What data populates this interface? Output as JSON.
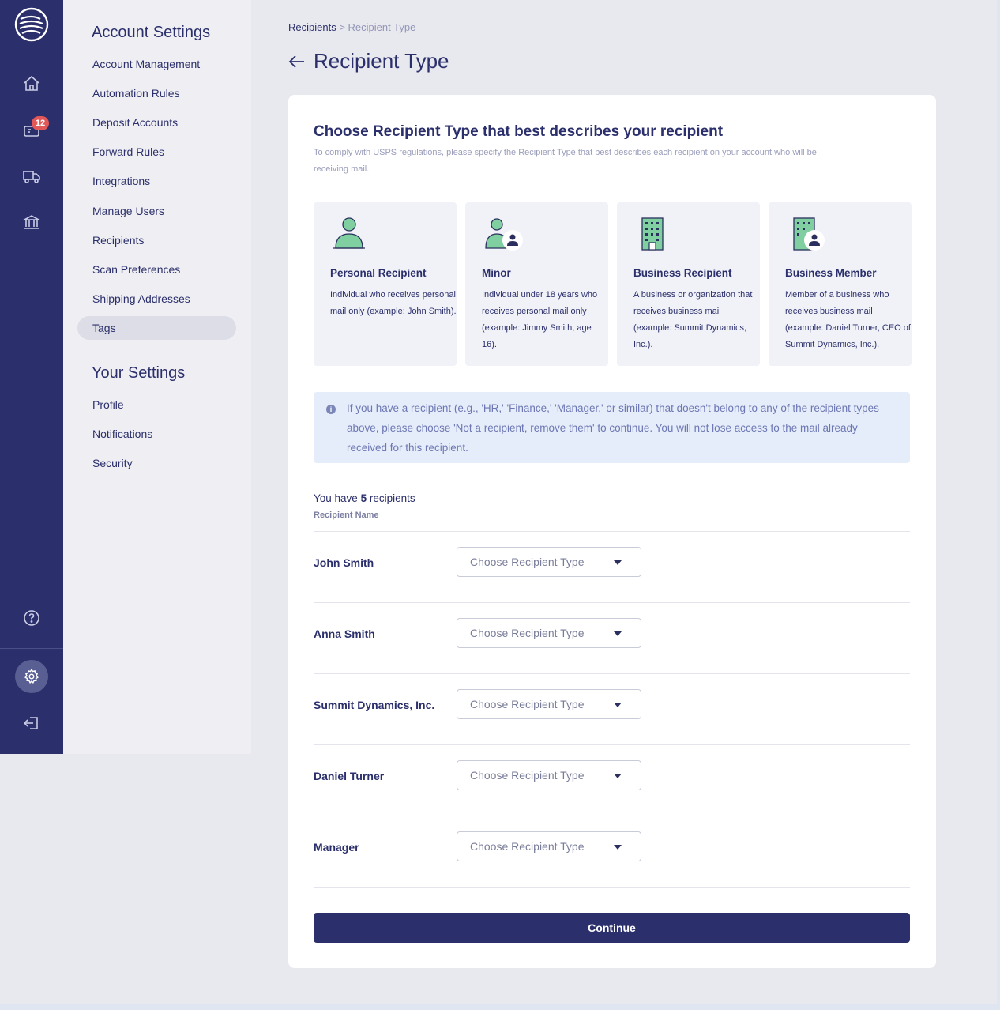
{
  "sidebar_rail": {
    "icons": [
      "logo-icon",
      "home-icon",
      "mailbox-icon",
      "truck-icon",
      "bank-icon",
      "help-icon",
      "gear-icon",
      "logout-icon"
    ],
    "mail_badge": "12"
  },
  "settings_menu": {
    "account_heading": "Account Settings",
    "account_items": [
      {
        "label": "Account Management"
      },
      {
        "label": "Automation Rules"
      },
      {
        "label": "Deposit Accounts"
      },
      {
        "label": "Forward Rules"
      },
      {
        "label": "Integrations"
      },
      {
        "label": "Manage Users"
      },
      {
        "label": "Recipients"
      },
      {
        "label": "Scan Preferences"
      },
      {
        "label": "Shipping Addresses"
      },
      {
        "label": "Tags"
      }
    ],
    "your_heading": "Your Settings",
    "your_items": [
      {
        "label": "Profile"
      },
      {
        "label": "Notifications"
      },
      {
        "label": "Security"
      }
    ]
  },
  "breadcrumb": {
    "parent": "Recipients",
    "separator": ">",
    "current": "Recipient Type"
  },
  "page_title": "Recipient Type",
  "card": {
    "heading": "Choose Recipient Type that best describes your recipient",
    "subheading": "To comply with USPS regulations, please specify the Recipient Type that best describes each recipient on your account who will be receiving mail.",
    "types": [
      {
        "name": "Personal Recipient",
        "description": "Individual who receives personal mail only (example: John Smith)."
      },
      {
        "name": "Minor",
        "description": "Individual under 18 years who receives personal mail only (example: Jimmy Smith, age 16)."
      },
      {
        "name": "Business Recipient",
        "description": "A business or organization that receives business mail (example: Summit Dynamics, Inc.)."
      },
      {
        "name": "Business Member",
        "description": "Member of a business who receives business mail (example: Daniel Turner, CEO of Summit Dynamics, Inc.)."
      }
    ],
    "info_text": "If you have a recipient (e.g., 'HR,' 'Finance,' 'Manager,' or similar) that doesn't belong to any of the recipient types above, please choose 'Not a recipient, remove them' to continue. You will not lose access to the mail already received for this recipient.",
    "count_prefix": "You have",
    "count_value": "5",
    "count_suffix": "recipients",
    "column_header": "Recipient Name",
    "select_placeholder": "Choose Recipient Type",
    "recipients": [
      {
        "name": "John Smith"
      },
      {
        "name": "Anna Smith"
      },
      {
        "name": "Summit Dynamics, Inc."
      },
      {
        "name": "Daniel Turner"
      },
      {
        "name": "Manager"
      }
    ],
    "continue_label": "Continue"
  },
  "colors": {
    "navy": "#2b2f6b",
    "accent_green": "#7fcfa0",
    "info_bg": "#e6edfa"
  }
}
